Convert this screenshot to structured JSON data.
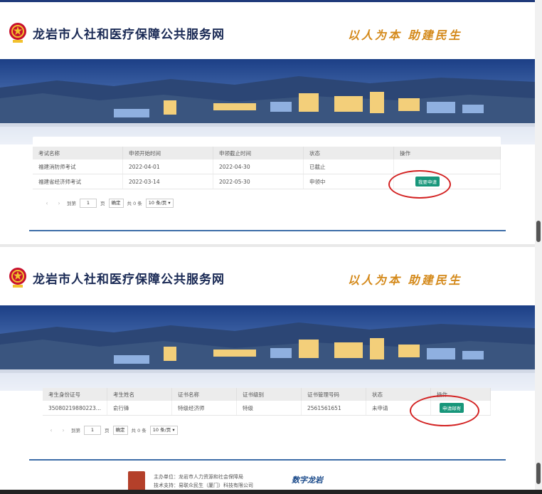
{
  "site": {
    "title": "龙岩市人社和医疗保障公共服务网",
    "slogan": "以人为本 助建民生"
  },
  "panel1": {
    "headers": [
      "考试名称",
      "申领开始时间",
      "申领截止时间",
      "状态",
      "操作"
    ],
    "rows": [
      {
        "name": "福建消防师考试",
        "start": "2022-04-01",
        "end": "2022-04-30",
        "status": "已截止",
        "action": ""
      },
      {
        "name": "福建省经济师考试",
        "start": "2022-03-14",
        "end": "2022-05-30",
        "status": "申领中",
        "action": "我要申请"
      }
    ],
    "pager": {
      "goto": "到第",
      "page": "1",
      "page_unit": "页",
      "confirm": "确定",
      "total": "共 0 条",
      "per_page": "10 条/页"
    }
  },
  "panel2": {
    "headers": [
      "考生身份证号",
      "考生姓名",
      "证书名称",
      "证书级别",
      "证书管理号码",
      "状态",
      "操作"
    ],
    "rows": [
      {
        "id": "35080219880223...",
        "name": "俞行锋",
        "cert": "特级经济师",
        "level": "特级",
        "number": "2561561651",
        "status": "未申请",
        "action": "申请邮寄"
      }
    ],
    "pager": {
      "goto": "到第",
      "page": "1",
      "page_unit": "页",
      "confirm": "确定",
      "total": "共 0 条",
      "per_page": "10 条/页"
    }
  },
  "footer": {
    "sponsor": "主办单位：龙岩市人力资源和社会保障局",
    "support": "技术支持：易联众民生（厦门）科技有限公司",
    "brand": "数字龙岩"
  },
  "colors": {
    "accent": "#17967a",
    "title": "#1a2a55",
    "slogan": "#d4891a",
    "highlight": "#d32222"
  }
}
